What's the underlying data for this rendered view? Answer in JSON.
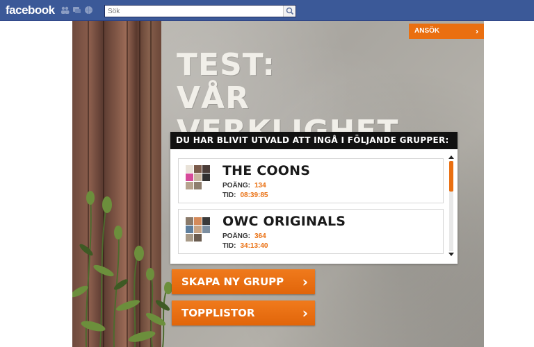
{
  "facebook": {
    "logo": "facebook",
    "search_placeholder": "Sök",
    "icons": [
      "friends-icon",
      "messages-icon",
      "notifications-icon",
      "search-icon"
    ]
  },
  "app": {
    "apply_button": "ANSÖK",
    "title_line1": "TEST:",
    "title_line2": "VÅR VERKLIGHET",
    "panel_header": "DU HAR BLIVIT UTVALD ATT INGÅ I FÖLJANDE GRUPPER:",
    "points_label": "POÄNG:",
    "time_label": "TID:",
    "groups": [
      {
        "name": "THE COONS",
        "points": "134",
        "time": "08:39:85"
      },
      {
        "name": "OWC ORIGINALS",
        "points": "364",
        "time": "34:13:40"
      }
    ],
    "create_group_button": "SKAPA NY GRUPP",
    "toplists_button": "TOPPLISTOR",
    "chevron": "›"
  },
  "colors": {
    "facebook_blue": "#3b5998",
    "accent_orange": "#ea6f10",
    "panel_header": "#111111"
  }
}
